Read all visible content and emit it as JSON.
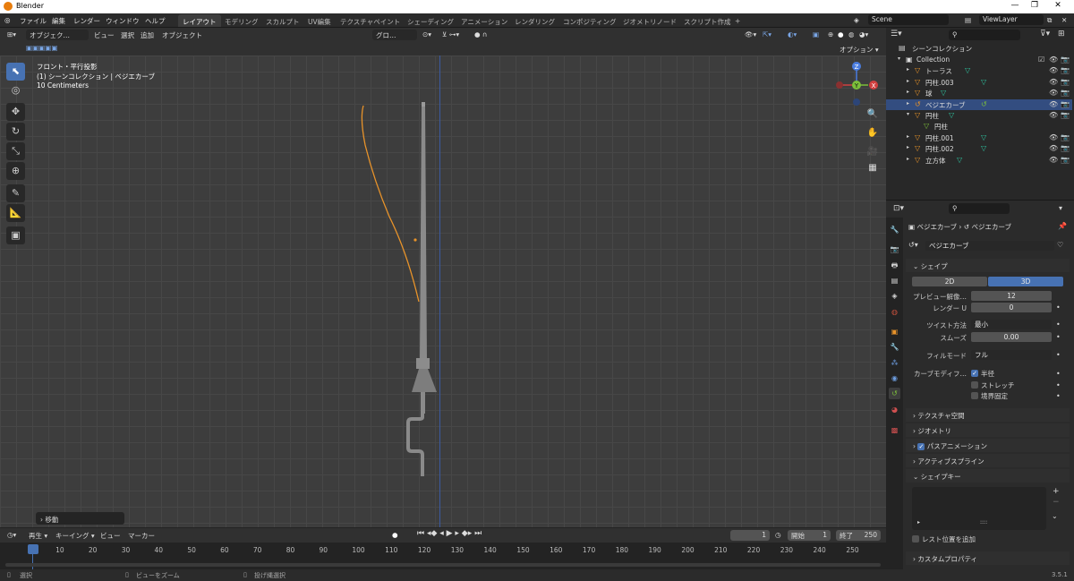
{
  "titlebar": {
    "title": "Blender"
  },
  "menu": {
    "file": "ファイル",
    "edit": "編集",
    "render": "レンダー",
    "window": "ウィンドウ",
    "help": "ヘルプ"
  },
  "workspaces": [
    "レイアウト",
    "モデリング",
    "スカルプト",
    "UV編集",
    "テクスチャペイント",
    "シェーディング",
    "アニメーション",
    "レンダリング",
    "コンポジティング",
    "ジオメトリノード",
    "スクリプト作成",
    "+"
  ],
  "scene": {
    "name": "Scene",
    "viewlayer": "ViewLayer"
  },
  "viewport_header": {
    "mode": "オブジェク…",
    "view": "ビュー",
    "select": "選択",
    "add": "追加",
    "object": "オブジェクト",
    "transform": "グロ…",
    "options": "オプション"
  },
  "overlay": {
    "line1": "フロント・平行投影",
    "line2": "(1) シーンコレクション | ベジエカーブ",
    "line3": "10 Centimeters"
  },
  "gizmo": {
    "z": "Z",
    "y": "Y",
    "x": "X"
  },
  "last_op": "移動",
  "outliner": {
    "root": "シーンコレクション",
    "items": [
      {
        "name": "Collection",
        "indent": 0
      },
      {
        "name": "トーラス",
        "indent": 1
      },
      {
        "name": "円柱.003",
        "indent": 1
      },
      {
        "name": "球",
        "indent": 1
      },
      {
        "name": "ベジエカーブ",
        "indent": 1
      },
      {
        "name": "円柱",
        "indent": 1
      },
      {
        "name": "円柱",
        "indent": 2
      },
      {
        "name": "円柱.001",
        "indent": 1
      },
      {
        "name": "円柱.002",
        "indent": 1
      },
      {
        "name": "立方体",
        "indent": 1
      }
    ]
  },
  "props": {
    "breadcrumb_obj": "ベジエカーブ",
    "breadcrumb_data": "ベジエカーブ",
    "data_name": "ベジエカーブ",
    "shape": "シェイプ",
    "btn2d": "2D",
    "btn3d": "3D",
    "preview_label": "プレビュー解像…",
    "preview_val": "12",
    "render_label": "レンダー U",
    "render_val": "0",
    "twist_label": "ツイスト方法",
    "twist_val": "最小",
    "smooth_label": "スムーズ",
    "smooth_val": "0.00",
    "fill_label": "フィルモード",
    "fill_val": "フル",
    "curvemod_label": "カーブモディフ…",
    "radius": "半径",
    "stretch": "ストレッチ",
    "bounds": "境界固定",
    "texspace": "テクスチャ空間",
    "geometry": "ジオメトリ",
    "pathanim": "パスアニメーション",
    "activespline": "アクティブスプライン",
    "shapekeys": "シェイプキー",
    "restpos": "レスト位置を追加",
    "custom": "カスタムプロパティ"
  },
  "timeline": {
    "playback": "再生",
    "keying": "キーイング",
    "view": "ビュー",
    "marker": "マーカー",
    "current": "1",
    "start_label": "開始",
    "start": "1",
    "end_label": "終了",
    "end": "250",
    "frames": [
      "1",
      "10",
      "20",
      "30",
      "40",
      "50",
      "60",
      "70",
      "80",
      "90",
      "100",
      "110",
      "120",
      "130",
      "140",
      "150",
      "160",
      "170",
      "180",
      "190",
      "200",
      "210",
      "220",
      "230",
      "240",
      "250"
    ]
  },
  "status": {
    "select": "選択",
    "zoom": "ビューをズーム",
    "lasso": "投げ縄選択",
    "version": "3.5.1"
  },
  "colors": {
    "accent": "#4772b3",
    "curve": "#e8932a",
    "selected_row": "#334d80"
  }
}
